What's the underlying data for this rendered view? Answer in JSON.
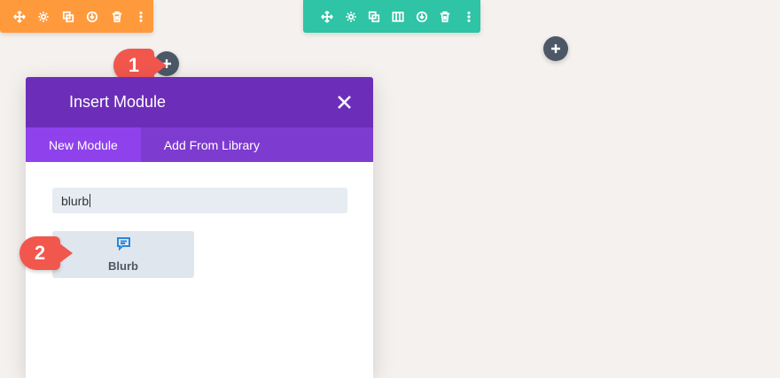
{
  "section_toolbar": {
    "icons": [
      "move-icon",
      "gear-icon",
      "duplicate-icon",
      "save-icon",
      "trash-icon",
      "more-icon"
    ],
    "color": "#ff9a3c"
  },
  "row_toolbar": {
    "icons": [
      "move-icon",
      "gear-icon",
      "duplicate-icon",
      "columns-icon",
      "save-icon",
      "trash-icon",
      "more-icon"
    ],
    "color": "#2ec4a5"
  },
  "markers": {
    "one": "1",
    "two": "2"
  },
  "modal": {
    "title": "Insert Module",
    "tabs": [
      {
        "label": "New Module",
        "active": true
      },
      {
        "label": "Add From Library",
        "active": false
      }
    ],
    "search_value": "blurb",
    "results": [
      {
        "label": "Blurb",
        "icon": "blurb-icon"
      }
    ],
    "header_color": "#6c2eb9",
    "tab_bar_color": "#7d3bcf",
    "active_tab_color": "#8f42ec"
  },
  "colors": {
    "marker": "#f2574e",
    "add_button": "#4c5866",
    "background": "#f5f1ee"
  }
}
